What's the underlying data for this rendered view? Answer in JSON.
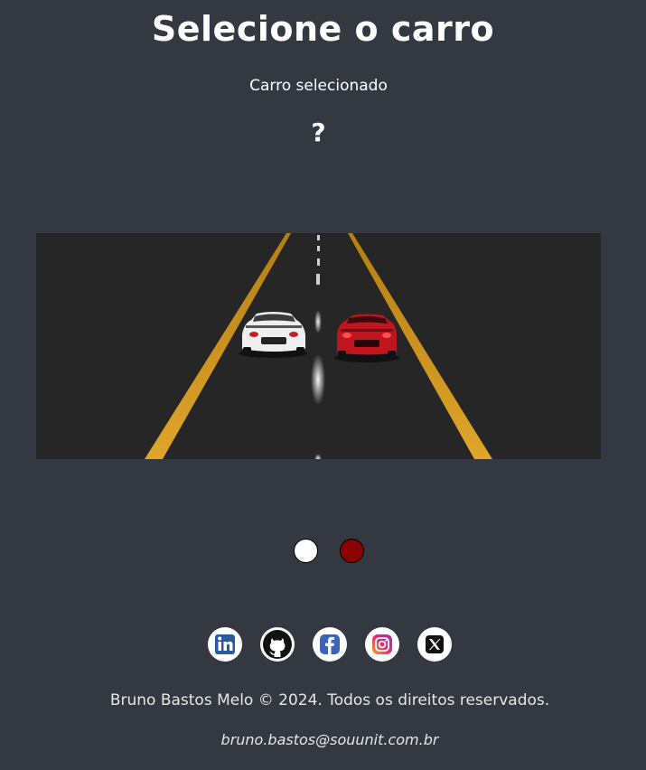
{
  "page": {
    "title": "Selecione o carro",
    "subtitle": "Carro selecionado",
    "selected_car": "?"
  },
  "scene": {
    "road_color": "#262626",
    "lane_line_color": "#d79a1e",
    "cars": [
      {
        "name": "white-car",
        "color": "#f2f2f2"
      },
      {
        "name": "red-car",
        "color": "#c0141e"
      }
    ]
  },
  "color_options": [
    {
      "name": "white",
      "color": "#ffffff"
    },
    {
      "name": "dark-red",
      "color": "#8b0000"
    }
  ],
  "socials": [
    {
      "name": "linkedin",
      "icon": "linkedin-icon"
    },
    {
      "name": "github",
      "icon": "github-icon"
    },
    {
      "name": "facebook",
      "icon": "facebook-icon"
    },
    {
      "name": "instagram",
      "icon": "instagram-icon"
    },
    {
      "name": "x",
      "icon": "x-icon"
    }
  ],
  "footer": {
    "copyright": "Bruno Bastos Melo © 2024. Todos os direitos reservados.",
    "email": "bruno.bastos@souunit.com.br"
  }
}
